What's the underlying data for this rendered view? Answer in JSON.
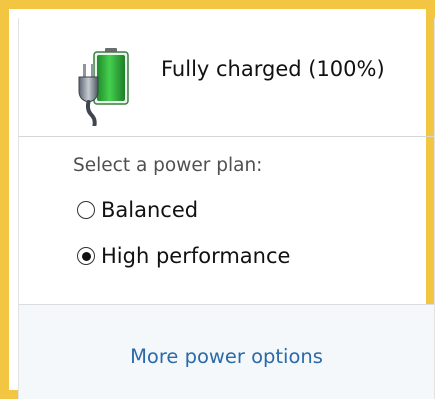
{
  "battery": {
    "status_text": "Fully charged (100%)",
    "charge_level": 100,
    "icon": "battery-plugged-in-icon",
    "fill_color": "#2fb33a"
  },
  "power_plan": {
    "label": "Select a power plan:",
    "options": [
      {
        "label": "Balanced",
        "selected": false
      },
      {
        "label": "High performance",
        "selected": true
      }
    ]
  },
  "footer": {
    "link_label": "More power options",
    "link_color": "#2a6aa8"
  },
  "frame": {
    "accent_color": "#f2c542"
  }
}
